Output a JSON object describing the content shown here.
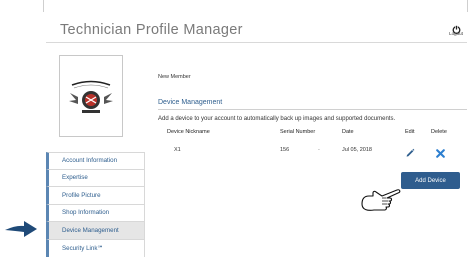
{
  "header": {
    "title": "Technician Profile Manager",
    "logout_label": "Logout"
  },
  "profile": {
    "member_status": "New Member",
    "logo_alt": "performance is key"
  },
  "device_management": {
    "section_title": "Device Management",
    "description": "Add a device to your account to automatically back up images and supported documents.",
    "columns": [
      "Device Nickname",
      "Serial Number",
      "Date",
      "Edit",
      "Delete"
    ],
    "rows": [
      {
        "nickname": "X1",
        "serial": "156",
        "separator": "-",
        "date": "Jul 05, 2018"
      }
    ],
    "add_button_label": "Add Device"
  },
  "sidebar": {
    "items": [
      {
        "label": "Account Information"
      },
      {
        "label": "Expertise"
      },
      {
        "label": "Profile Picture"
      },
      {
        "label": "Shop Information"
      },
      {
        "label": "Device Management",
        "active": true
      },
      {
        "label": "Security Link℠"
      }
    ]
  },
  "colors": {
    "accent": "#2f5d8e",
    "link": "#2e5e8e",
    "delete": "#2d7fd0",
    "sidebar_active": "#e6e6e6"
  },
  "icons": [
    "logout-icon",
    "pencil-icon",
    "close-icon",
    "pointing-hand-icon",
    "arrow-right-icon"
  ]
}
